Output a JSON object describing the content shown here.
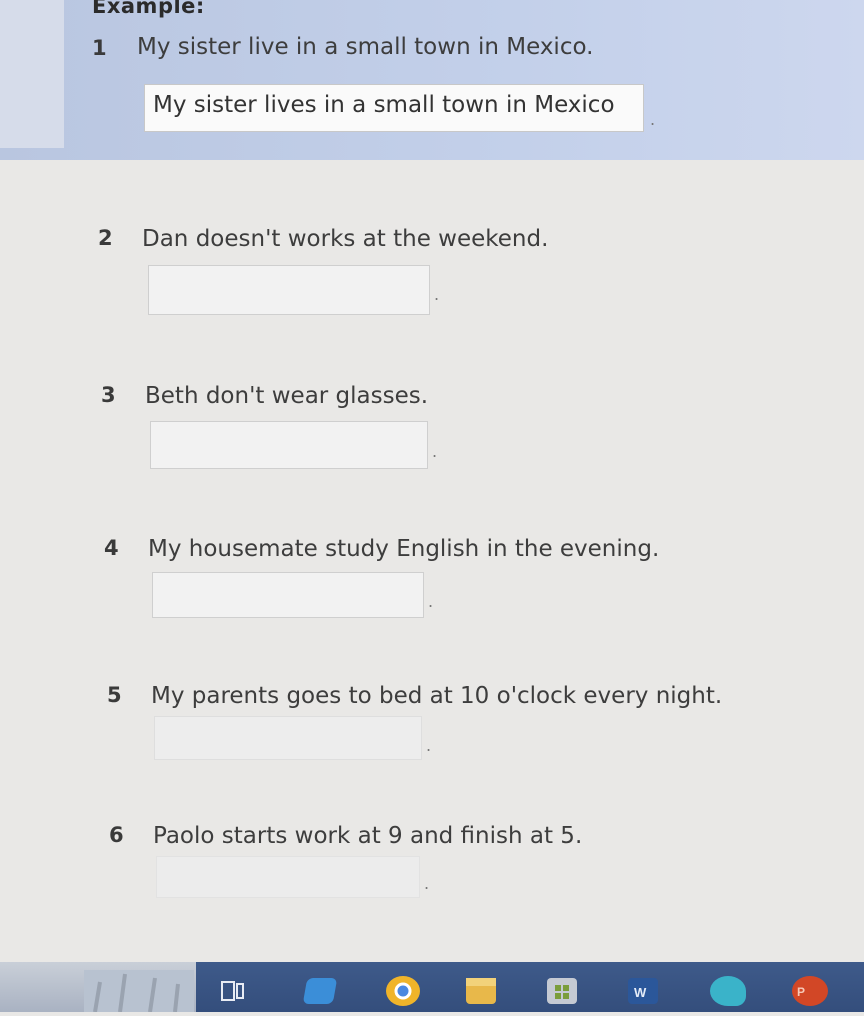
{
  "example": {
    "title": "Example:",
    "number": "1",
    "sentence": "My sister live in a small town in Mexico.",
    "answer": "My sister lives in a small town in Mexico"
  },
  "questions": [
    {
      "number": "2",
      "sentence": "Dan doesn't works at the weekend.",
      "answer": ""
    },
    {
      "number": "3",
      "sentence": "Beth don't wear glasses.",
      "answer": ""
    },
    {
      "number": "4",
      "sentence": "My housemate study English in the evening.",
      "answer": ""
    },
    {
      "number": "5",
      "sentence": "My parents goes to bed at 10 o'clock every night.",
      "answer": ""
    },
    {
      "number": "6",
      "sentence": "Paolo starts work at 9 and finish at 5.",
      "answer": ""
    }
  ],
  "answer_suffix": ".",
  "taskbar": {
    "icons": [
      "task-view-icon",
      "mail-icon",
      "chrome-icon",
      "file-explorer-icon",
      "store-icon",
      "word-icon",
      "edge-icon",
      "powerpoint-icon"
    ],
    "colors": {
      "chrome": "#f0b429",
      "word": "#2b579a",
      "powerpoint": "#d24726",
      "edge": "#3ab3c9",
      "explorer": "#e8b84a",
      "mail": "#3b8ed8"
    }
  }
}
